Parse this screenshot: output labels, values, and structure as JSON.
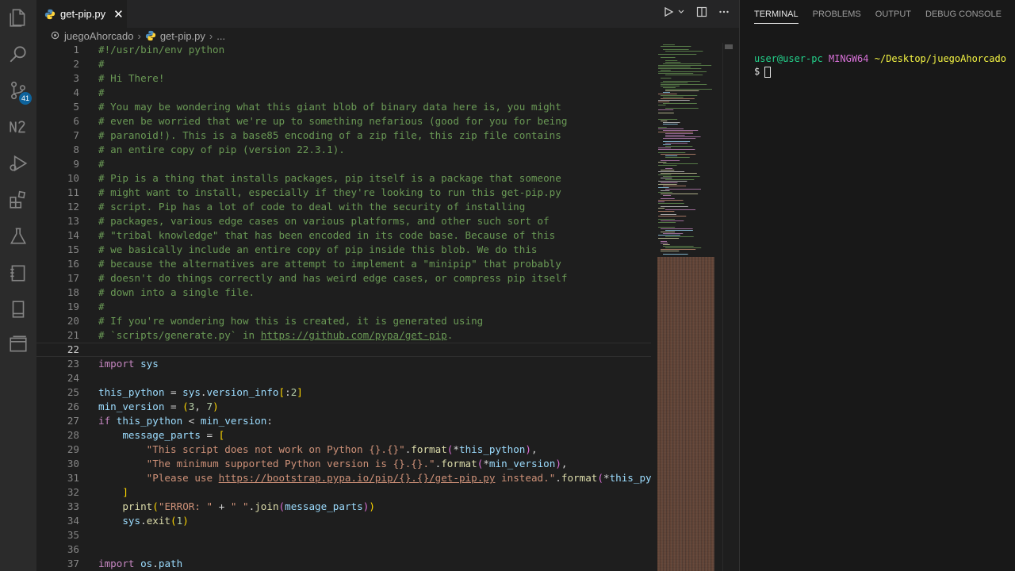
{
  "activity_bar": {
    "items": [
      {
        "name": "explorer-icon"
      },
      {
        "name": "search-icon"
      },
      {
        "name": "source-control-icon"
      },
      {
        "name": "numbered-list-icon"
      },
      {
        "name": "run-debug-icon"
      },
      {
        "name": "extensions-icon"
      },
      {
        "name": "testing-icon"
      },
      {
        "name": "notebook-icon"
      },
      {
        "name": "book-icon"
      },
      {
        "name": "panels-icon"
      }
    ],
    "source_control_badge": "41"
  },
  "tab": {
    "label": "get-pip.py",
    "close": "✕"
  },
  "breadcrumb": {
    "folder": "juegoAhorcado",
    "file": "get-pip.py",
    "more": "..."
  },
  "editor": {
    "current_line": 22,
    "lines": [
      {
        "n": "1",
        "t": [
          [
            "c-cm",
            "#!/usr/bin/env python"
          ]
        ]
      },
      {
        "n": "2",
        "t": [
          [
            "c-cm",
            "#"
          ]
        ]
      },
      {
        "n": "3",
        "t": [
          [
            "c-cm",
            "# Hi There!"
          ]
        ]
      },
      {
        "n": "4",
        "t": [
          [
            "c-cm",
            "#"
          ]
        ]
      },
      {
        "n": "5",
        "t": [
          [
            "c-cm",
            "# You may be wondering what this giant blob of binary data here is, you might"
          ]
        ]
      },
      {
        "n": "6",
        "t": [
          [
            "c-cm",
            "# even be worried that we're up to something nefarious (good for you for being"
          ]
        ]
      },
      {
        "n": "7",
        "t": [
          [
            "c-cm",
            "# paranoid!). This is a base85 encoding of a zip file, this zip file contains"
          ]
        ]
      },
      {
        "n": "8",
        "t": [
          [
            "c-cm",
            "# an entire copy of pip (version 22.3.1)."
          ]
        ]
      },
      {
        "n": "9",
        "t": [
          [
            "c-cm",
            "#"
          ]
        ]
      },
      {
        "n": "10",
        "t": [
          [
            "c-cm",
            "# Pip is a thing that installs packages, pip itself is a package that someone"
          ]
        ]
      },
      {
        "n": "11",
        "t": [
          [
            "c-cm",
            "# might want to install, especially if they're looking to run this get-pip.py"
          ]
        ]
      },
      {
        "n": "12",
        "t": [
          [
            "c-cm",
            "# script. Pip has a lot of code to deal with the security of installing"
          ]
        ]
      },
      {
        "n": "13",
        "t": [
          [
            "c-cm",
            "# packages, various edge cases on various platforms, and other such sort of"
          ]
        ]
      },
      {
        "n": "14",
        "t": [
          [
            "c-cm",
            "# \"tribal knowledge\" that has been encoded in its code base. Because of this"
          ]
        ]
      },
      {
        "n": "15",
        "t": [
          [
            "c-cm",
            "# we basically include an entire copy of pip inside this blob. We do this"
          ]
        ]
      },
      {
        "n": "16",
        "t": [
          [
            "c-cm",
            "# because the alternatives are attempt to implement a \"minipip\" that probably"
          ]
        ]
      },
      {
        "n": "17",
        "t": [
          [
            "c-cm",
            "# doesn't do things correctly and has weird edge cases, or compress pip itself"
          ]
        ]
      },
      {
        "n": "18",
        "t": [
          [
            "c-cm",
            "# down into a single file."
          ]
        ]
      },
      {
        "n": "19",
        "t": [
          [
            "c-cm",
            "#"
          ]
        ]
      },
      {
        "n": "20",
        "t": [
          [
            "c-cm",
            "# If you're wondering how this is created, it is generated using"
          ]
        ]
      },
      {
        "n": "21",
        "t": [
          [
            "c-cm",
            "# `scripts/generate.py` in "
          ],
          [
            "c-cm c-link",
            "https://github.com/pypa/get-pip"
          ],
          [
            "c-cm",
            "."
          ]
        ]
      },
      {
        "n": "22",
        "t": []
      },
      {
        "n": "23",
        "t": [
          [
            "c-kw",
            "import"
          ],
          [
            "c-op",
            " "
          ],
          [
            "c-var",
            "sys"
          ]
        ]
      },
      {
        "n": "24",
        "t": []
      },
      {
        "n": "25",
        "t": [
          [
            "c-var",
            "this_python"
          ],
          [
            "c-op",
            " = "
          ],
          [
            "c-var",
            "sys"
          ],
          [
            "c-op",
            "."
          ],
          [
            "c-var",
            "version_info"
          ],
          [
            "c-br1",
            "["
          ],
          [
            "c-op",
            ":"
          ],
          [
            "c-num",
            "2"
          ],
          [
            "c-br1",
            "]"
          ]
        ]
      },
      {
        "n": "26",
        "t": [
          [
            "c-var",
            "min_version"
          ],
          [
            "c-op",
            " = "
          ],
          [
            "c-br1",
            "("
          ],
          [
            "c-num",
            "3"
          ],
          [
            "c-op",
            ", "
          ],
          [
            "c-num",
            "7"
          ],
          [
            "c-br1",
            ")"
          ]
        ]
      },
      {
        "n": "27",
        "t": [
          [
            "c-kw",
            "if"
          ],
          [
            "c-op",
            " "
          ],
          [
            "c-var",
            "this_python"
          ],
          [
            "c-op",
            " < "
          ],
          [
            "c-var",
            "min_version"
          ],
          [
            "c-op",
            ":"
          ]
        ]
      },
      {
        "n": "28",
        "t": [
          [
            "c-op",
            "    "
          ],
          [
            "c-var",
            "message_parts"
          ],
          [
            "c-op",
            " = "
          ],
          [
            "c-br1",
            "["
          ]
        ]
      },
      {
        "n": "29",
        "t": [
          [
            "c-op",
            "        "
          ],
          [
            "c-str",
            "\"This script does not work on Python {}.{}\""
          ],
          [
            "c-op",
            "."
          ],
          [
            "c-fn",
            "format"
          ],
          [
            "c-br2",
            "("
          ],
          [
            "c-op",
            "*"
          ],
          [
            "c-var",
            "this_python"
          ],
          [
            "c-br2",
            ")"
          ],
          [
            "c-op",
            ","
          ]
        ]
      },
      {
        "n": "30",
        "t": [
          [
            "c-op",
            "        "
          ],
          [
            "c-str",
            "\"The minimum supported Python version is {}.{}.\""
          ],
          [
            "c-op",
            "."
          ],
          [
            "c-fn",
            "format"
          ],
          [
            "c-br2",
            "("
          ],
          [
            "c-op",
            "*"
          ],
          [
            "c-var",
            "min_version"
          ],
          [
            "c-br2",
            ")"
          ],
          [
            "c-op",
            ","
          ]
        ]
      },
      {
        "n": "31",
        "t": [
          [
            "c-op",
            "        "
          ],
          [
            "c-str",
            "\"Please use "
          ],
          [
            "c-str c-link",
            "https://bootstrap.pypa.io/pip/{}.{}/get-pip.py"
          ],
          [
            "c-str",
            " instead.\""
          ],
          [
            "c-op",
            "."
          ],
          [
            "c-fn",
            "format"
          ],
          [
            "c-br2",
            "("
          ],
          [
            "c-op",
            "*"
          ],
          [
            "c-var",
            "this_python"
          ]
        ]
      },
      {
        "n": "32",
        "t": [
          [
            "c-op",
            "    "
          ],
          [
            "c-br1",
            "]"
          ]
        ]
      },
      {
        "n": "33",
        "t": [
          [
            "c-op",
            "    "
          ],
          [
            "c-fn",
            "print"
          ],
          [
            "c-br1",
            "("
          ],
          [
            "c-str",
            "\"ERROR: \""
          ],
          [
            "c-op",
            " + "
          ],
          [
            "c-str",
            "\" \""
          ],
          [
            "c-op",
            "."
          ],
          [
            "c-fn",
            "join"
          ],
          [
            "c-br2",
            "("
          ],
          [
            "c-var",
            "message_parts"
          ],
          [
            "c-br2",
            ")"
          ],
          [
            "c-br1",
            ")"
          ]
        ]
      },
      {
        "n": "34",
        "t": [
          [
            "c-op",
            "    "
          ],
          [
            "c-var",
            "sys"
          ],
          [
            "c-op",
            "."
          ],
          [
            "c-fn",
            "exit"
          ],
          [
            "c-br1",
            "("
          ],
          [
            "c-num",
            "1"
          ],
          [
            "c-br1",
            ")"
          ]
        ]
      },
      {
        "n": "35",
        "t": []
      },
      {
        "n": "36",
        "t": []
      },
      {
        "n": "37",
        "t": [
          [
            "c-kw",
            "import"
          ],
          [
            "c-op",
            " "
          ],
          [
            "c-var",
            "os"
          ],
          [
            "c-op",
            "."
          ],
          [
            "c-var",
            "path"
          ]
        ]
      }
    ]
  },
  "panel": {
    "tabs": [
      "TERMINAL",
      "PROBLEMS",
      "OUTPUT",
      "DEBUG CONSOLE"
    ],
    "active_tab": "TERMINAL",
    "terminal": {
      "user": "user@user-pc",
      "shell": "MINGW64",
      "path": "~/Desktop/juegoAhorcado",
      "prompt": "$"
    }
  },
  "colors": {
    "editor_bg": "#1e1e1e",
    "comment": "#6a9955",
    "keyword": "#c586c0",
    "variable": "#9cdcfe",
    "string": "#ce9178"
  }
}
